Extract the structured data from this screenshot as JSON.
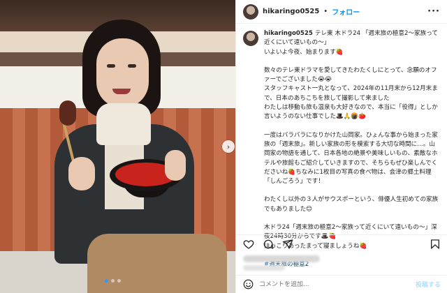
{
  "header": {
    "username": "hikaringo0525",
    "separator": "•",
    "follow_label": "フォロー",
    "more_label": "···"
  },
  "caption": {
    "username": "hikaringo0525",
    "lines": [
      "テレ東 木ドラ24 「週末旅の極意2〜家族って近くにいて遠いもの〜」",
      "いよいよ今夜、始まります🍓",
      "",
      "数々のテレ東ドラマを愛してきたわたくしにとって、念願のオファーでございました😭😭",
      "スタッフキャスト一丸となって、2024年の11月末から12月末まで、日本のあちこちを旅して撮影して来ました",
      "わたしは移動も旅も温泉も大好きなので、本当に「役得」としか言いようのない仕事でした🎩🙏🍘🍅",
      "",
      "一度はバラバラになりかけた山岡家。ひょんな事から始まった家族の「週末旅」。新しい家族の形を模索する大切な時間に…。山岡家の物語を通して、日本各地の絶景や美味しいもの、素敵なホテルや旅館もご紹介していきますので、そちらもぜひ楽しんでくださいね🍓ちなみに1枚目の写真の食べ物は、会津の郷土料理「しんごろう」です！",
      "",
      "わたくし以外の３人がサウスポーという、俳優人生初めての家族でもありました😊",
      "",
      "木ドラ24「週末旅の極意2～家族って近くにいて遠いもの～」深夜24時30分からです🎩🍓",
      "ほっこりあったまって寝ましょうね🍓",
      "",
      "#週末旅の極意2"
    ]
  },
  "actions": {
    "like_icon": "heart-icon",
    "comment_icon": "comment-icon",
    "share_icon": "share-icon",
    "save_icon": "bookmark-icon"
  },
  "comment_bar": {
    "placeholder": "コメントを追加...",
    "post_label": "投稿する"
  },
  "carousel": {
    "next_icon": "chevron-right-icon",
    "total_slides": 3,
    "active_slide": 1
  },
  "colors": {
    "link_blue": "#0095f6",
    "hashtag": "#00376b",
    "post_disabled": "#b2dffc"
  }
}
